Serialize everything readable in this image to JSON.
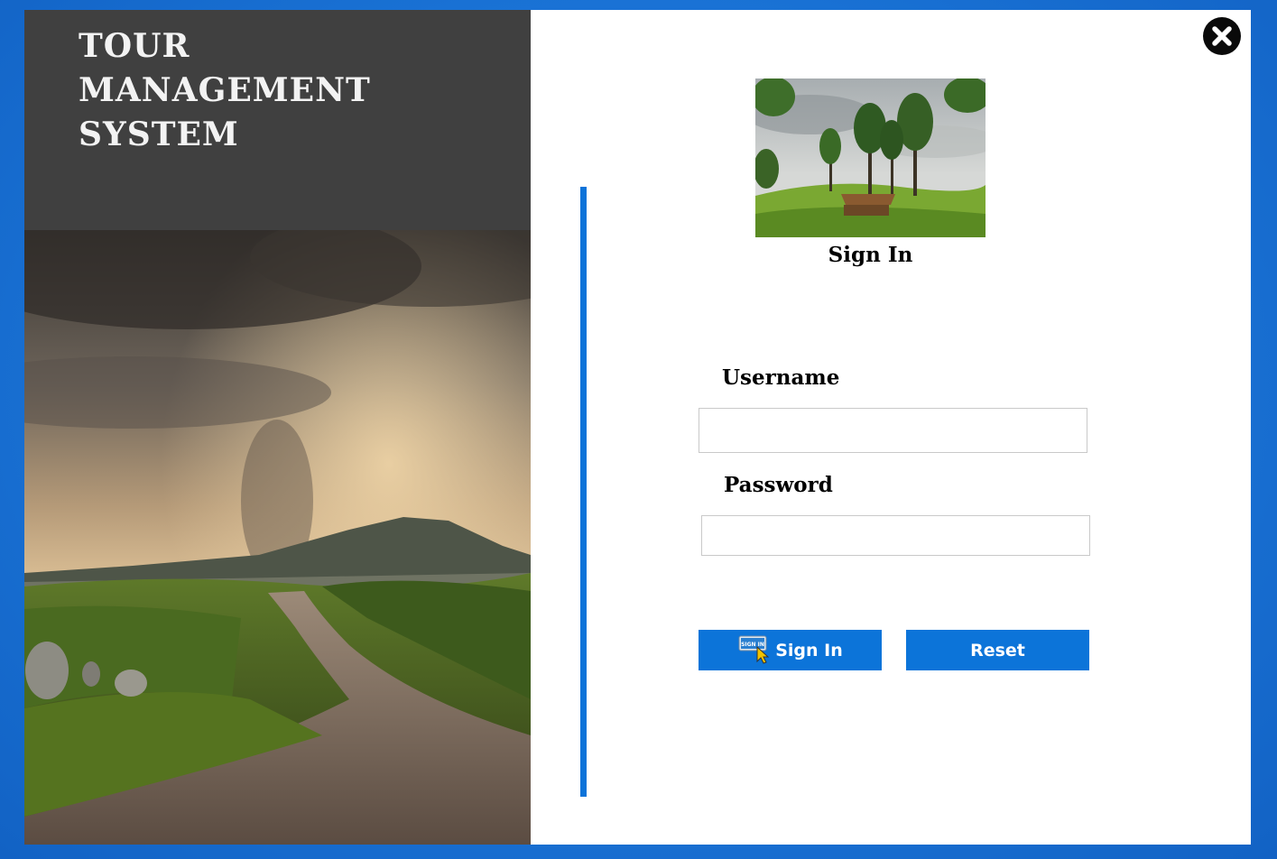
{
  "app": {
    "title_lines": [
      "Tour",
      "Management",
      "System"
    ]
  },
  "form": {
    "heading": "Sign In",
    "username_label": "Username",
    "username_value": "",
    "password_label": "Password",
    "password_value": "",
    "signin_button_label": "Sign In",
    "signin_icon_text": "SIGN IN",
    "reset_button_label": "Reset"
  },
  "icons": {
    "close": "close-icon",
    "signin": "sign-in-cursor-icon"
  },
  "colors": {
    "accent": "#0c74d9",
    "title_block": "#404040",
    "desktop_background": "#1a73d6"
  }
}
